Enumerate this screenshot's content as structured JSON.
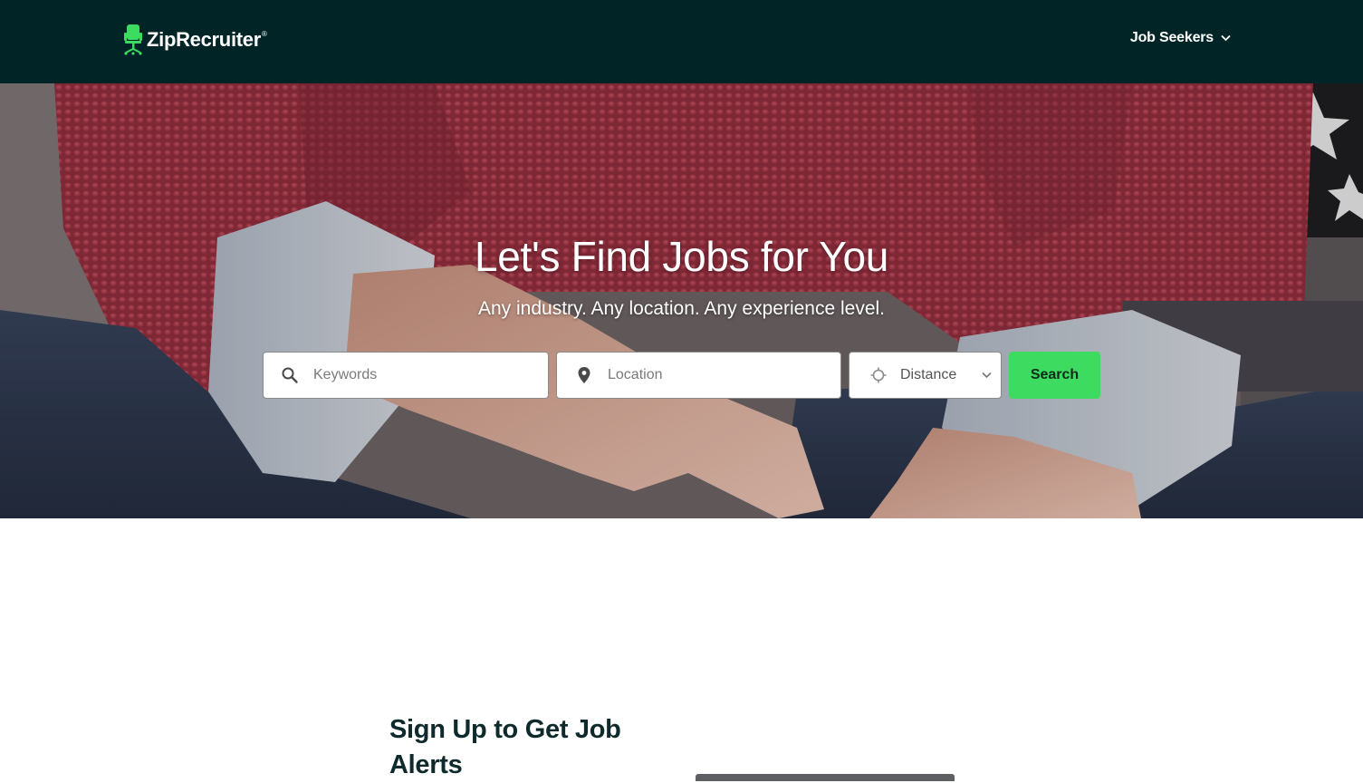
{
  "header": {
    "logo_text": "ZipRecruiter",
    "logo_mark": "®",
    "nav_menu_label": "Job Seekers",
    "colors": {
      "background": "#012526",
      "brand_green": "#3edb61"
    }
  },
  "hero": {
    "title": "Let's Find Jobs for You",
    "subtitle": "Any industry. Any location. Any experience level.",
    "search": {
      "keywords_placeholder": "Keywords",
      "location_placeholder": "Location",
      "distance_label": "Distance",
      "search_button": "Search"
    }
  },
  "signup": {
    "title": "Sign Up to Get Job Alerts"
  }
}
